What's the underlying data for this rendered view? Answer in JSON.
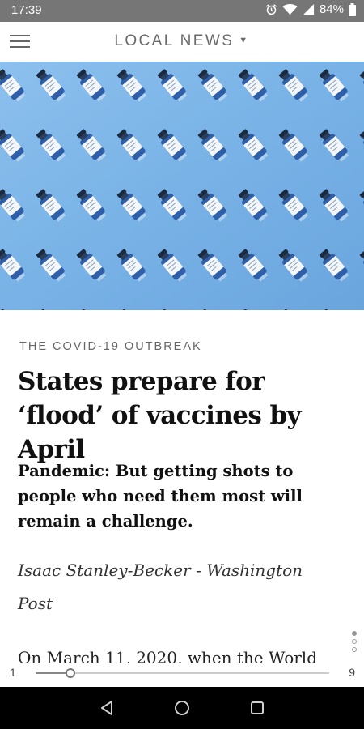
{
  "status_bar": {
    "time": "17:39",
    "battery": "84%"
  },
  "app_bar": {
    "section_title": "LOCAL NEWS"
  },
  "article": {
    "kicker": "THE COVID-19 OUTBREAK",
    "headline": "States prepare for ‘flood’ of vaccines by April",
    "dek": "Pandemic: But getting shots to people who need them most will remain a challenge.",
    "byline": "Isaac Stanley-Becker - Washington Post",
    "body_start": "On March 11, 2020, when the World"
  },
  "pager": {
    "min_label": "1",
    "max_label": "9",
    "current_page": 2,
    "total_pages": 9
  },
  "colors": {
    "status_bar": "#767676",
    "hero_background": "#7cb4e8",
    "vial_liquid": "#2f5fa8"
  },
  "icons": [
    "alarm-icon",
    "wifi-icon",
    "signal-icon",
    "battery-icon",
    "menu-icon",
    "caret-down-icon",
    "back-icon",
    "home-icon",
    "recents-icon"
  ]
}
